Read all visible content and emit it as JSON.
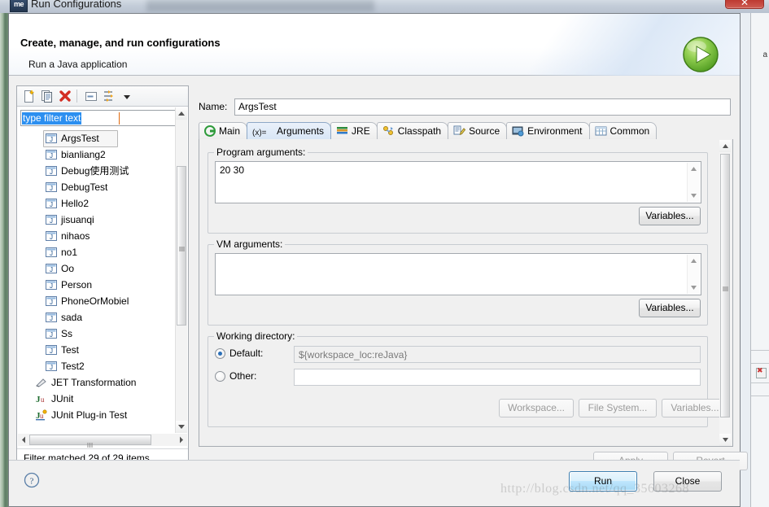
{
  "window": {
    "title": "Run Configurations",
    "icon": "eclipse-icon",
    "close_label": "✕"
  },
  "header": {
    "title": "Create, manage, and run configurations",
    "subtitle": "Run a Java application",
    "run_icon": "run-play-icon"
  },
  "left_panel": {
    "toolbar": [
      {
        "name": "new-configuration-icon",
        "tooltip": "New launch configuration"
      },
      {
        "name": "duplicate-configuration-icon",
        "tooltip": "Duplicate"
      },
      {
        "name": "delete-configuration-icon",
        "tooltip": "Delete"
      },
      {
        "name": "collapse-all-icon",
        "tooltip": "Collapse All"
      },
      {
        "name": "filter-icon",
        "tooltip": "Filter"
      },
      {
        "name": "chevron-down-icon",
        "tooltip": "Menu"
      }
    ],
    "filter": {
      "value": "type filter text",
      "placeholder": "type filter text"
    },
    "tree": [
      {
        "label": "ArgsTest",
        "icon": "java-file-icon",
        "level": 2,
        "selected": true
      },
      {
        "label": "bianliang2",
        "icon": "java-file-icon",
        "level": 2,
        "selected": false
      },
      {
        "label": "Debug使用测试",
        "icon": "java-file-icon",
        "level": 2,
        "selected": false
      },
      {
        "label": "DebugTest",
        "icon": "java-file-icon",
        "level": 2,
        "selected": false
      },
      {
        "label": "Hello2",
        "icon": "java-file-icon",
        "level": 2,
        "selected": false
      },
      {
        "label": "jisuanqi",
        "icon": "java-file-icon",
        "level": 2,
        "selected": false
      },
      {
        "label": "nihaos",
        "icon": "java-file-icon",
        "level": 2,
        "selected": false
      },
      {
        "label": "no1",
        "icon": "java-file-icon",
        "level": 2,
        "selected": false
      },
      {
        "label": "Oo",
        "icon": "java-file-icon",
        "level": 2,
        "selected": false
      },
      {
        "label": "Person",
        "icon": "java-file-icon",
        "level": 2,
        "selected": false
      },
      {
        "label": "PhoneOrMobiel",
        "icon": "java-file-icon",
        "level": 2,
        "selected": false
      },
      {
        "label": "sada",
        "icon": "java-file-icon",
        "level": 2,
        "selected": false
      },
      {
        "label": "Ss",
        "icon": "java-file-icon",
        "level": 2,
        "selected": false
      },
      {
        "label": "Test",
        "icon": "java-file-icon",
        "level": 2,
        "selected": false
      },
      {
        "label": "Test2",
        "icon": "java-file-icon",
        "level": 2,
        "selected": false
      },
      {
        "label": "JET Transformation",
        "icon": "jet-transform-icon",
        "level": 1,
        "selected": false
      },
      {
        "label": "JUnit",
        "icon": "junit-icon",
        "level": 1,
        "selected": false
      },
      {
        "label": "JUnit Plug-in Test",
        "icon": "junit-plugin-icon",
        "level": 1,
        "selected": false
      }
    ],
    "status": "Filter matched 29 of 29 items"
  },
  "right_panel": {
    "name_label": "Name:",
    "name_value": "ArgsTest",
    "tabs": [
      {
        "label": "Main",
        "icon": "main-icon",
        "active": false
      },
      {
        "label": "Arguments",
        "icon": "arguments-icon",
        "active": true
      },
      {
        "label": "JRE",
        "icon": "jre-icon",
        "active": false
      },
      {
        "label": "Classpath",
        "icon": "classpath-icon",
        "active": false
      },
      {
        "label": "Source",
        "icon": "source-icon",
        "active": false
      },
      {
        "label": "Environment",
        "icon": "environment-icon",
        "active": false
      },
      {
        "label": "Common",
        "icon": "common-icon",
        "active": false
      }
    ],
    "program_arguments": {
      "group_label": "Program arguments:",
      "value": "20 30",
      "variables_button": "Variables..."
    },
    "vm_arguments": {
      "group_label": "VM arguments:",
      "value": "",
      "variables_button": "Variables..."
    },
    "working_directory": {
      "group_label": "Working directory:",
      "default_label": "Default:",
      "default_value": "${workspace_loc:reJava}",
      "default_selected": true,
      "other_label": "Other:",
      "other_value": "",
      "other_selected": false,
      "workspace_button": "Workspace...",
      "filesystem_button": "File System...",
      "variables_button": "Variables..."
    },
    "apply_button": "Apply",
    "revert_button": "Revert"
  },
  "footer": {
    "help_icon": "help-question-icon",
    "run_button": "Run",
    "close_button": "Close"
  },
  "watermark": "http://blog.csdn.net/qq_35603268",
  "colors": {
    "accent_blue": "#2c8ff0",
    "active_tab": "#d8e6f6",
    "run_green": "#63b32a",
    "close_red": "#d4534a",
    "dialog_bg": "#f0f0f0"
  }
}
